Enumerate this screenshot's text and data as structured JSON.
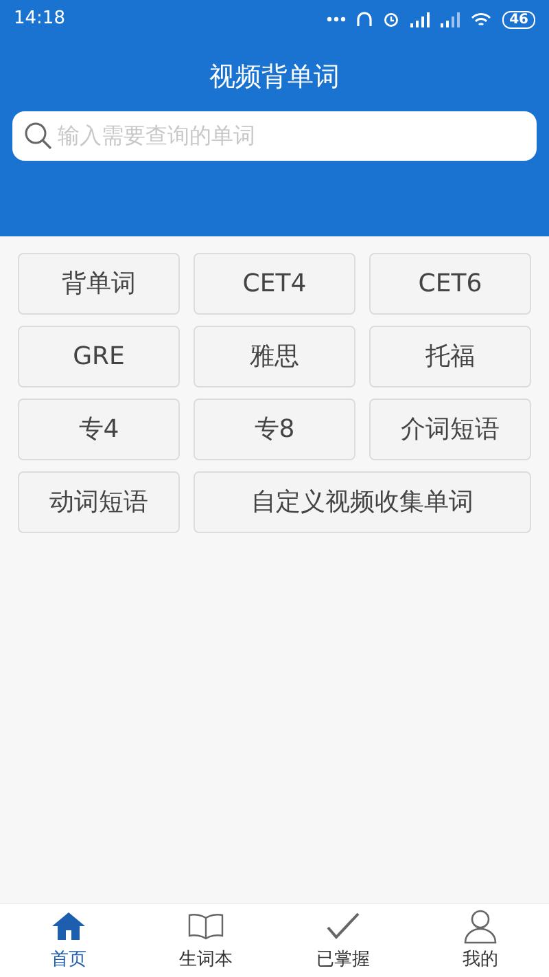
{
  "status_bar": {
    "time": "14:18",
    "battery": "46"
  },
  "header": {
    "title": "视频背单词"
  },
  "search": {
    "placeholder": "输入需要查询的单词"
  },
  "categories": [
    {
      "label": "背单词"
    },
    {
      "label": "CET4"
    },
    {
      "label": "CET6"
    },
    {
      "label": "GRE"
    },
    {
      "label": "雅思"
    },
    {
      "label": "托福"
    },
    {
      "label": "专4"
    },
    {
      "label": "专8"
    },
    {
      "label": "介词短语"
    },
    {
      "label": "动词短语"
    },
    {
      "label": "自定义视频收集单词"
    }
  ],
  "bottom_nav": [
    {
      "label": "首页",
      "selected": true
    },
    {
      "label": "生词本",
      "selected": false
    },
    {
      "label": "已掌握",
      "selected": false
    },
    {
      "label": "我的",
      "selected": false
    }
  ]
}
